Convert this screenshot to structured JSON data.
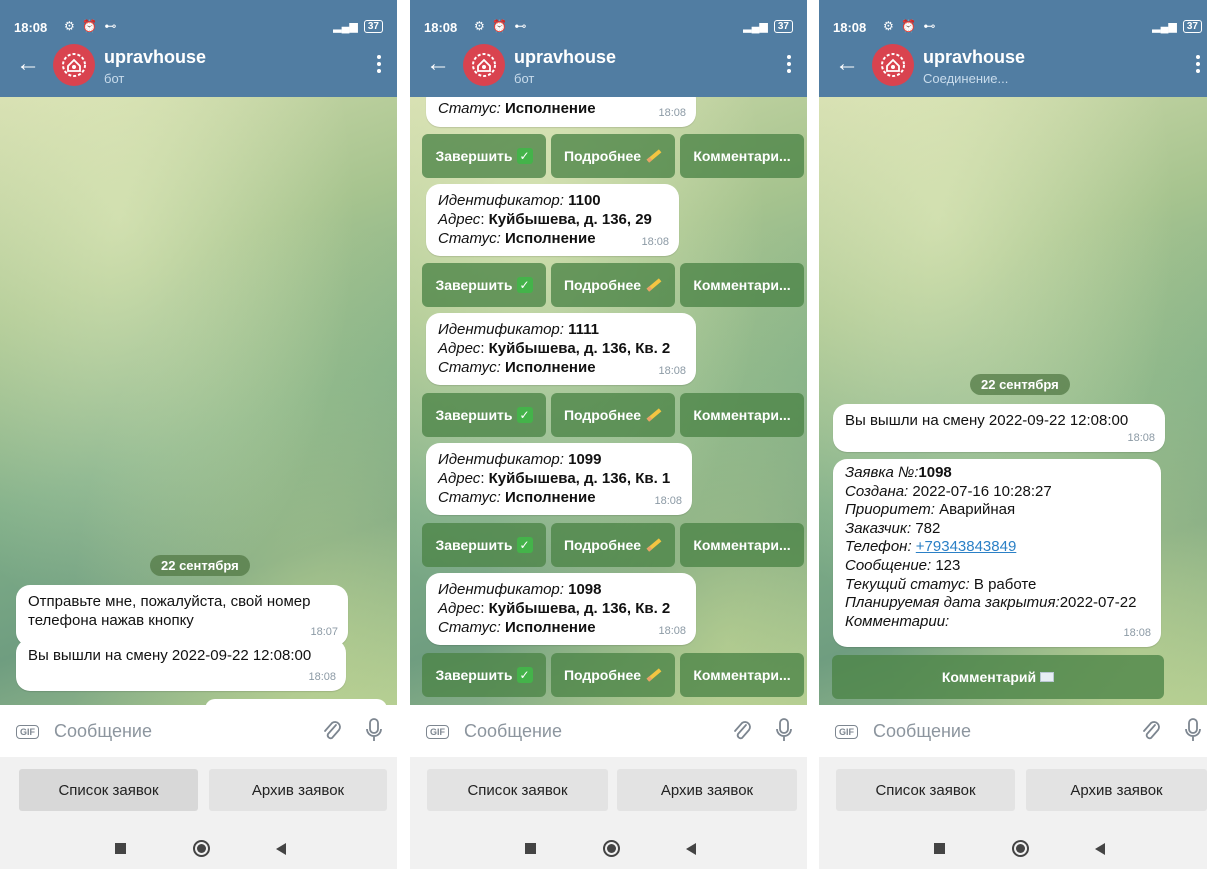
{
  "status_bar": {
    "time": "18:08",
    "icons": "⚙ ⏰ ⊷",
    "battery": "37",
    "signal": "📶"
  },
  "panels": [
    {
      "chat_title": "upravhouse",
      "chat_subtitle": "бот",
      "date_pill": "22 сентября",
      "messages": [
        {
          "text": "Отправьте мне, пожалуйста, свой номер телефона нажав кнопку",
          "time": "18:07"
        },
        {
          "text": "Вы вышли на смену 2022-09-22 12:08:00",
          "time": "18:08"
        }
      ]
    },
    {
      "chat_title": "upravhouse",
      "chat_subtitle": "бот",
      "top_partial": {
        "status_label": "Статус:",
        "status_value": "Исполнение",
        "time": "18:08"
      },
      "orders": [
        {
          "id_label": "Идентификатор:",
          "id": "1100",
          "addr_label": "Адрес",
          "addr": "Куйбышева, д. 136, 29",
          "status_label": "Статус:",
          "status": "Исполнение",
          "time": "18:08"
        },
        {
          "id_label": "Идентификатор:",
          "id": "1111",
          "addr_label": "Адрес",
          "addr": "Куйбышева, д. 136, Кв. 2",
          "status_label": "Статус:",
          "status": "Исполнение",
          "time": "18:08"
        },
        {
          "id_label": "Идентификатор:",
          "id": "1099",
          "addr_label": "Адрес",
          "addr": "Куйбышева, д. 136, Кв. 1",
          "status_label": "Статус:",
          "status": "Исполнение",
          "time": "18:08"
        },
        {
          "id_label": "Идентификатор:",
          "id": "1098",
          "addr_label": "Адрес",
          "addr": "Куйбышева, д. 136, Кв. 2",
          "status_label": "Статус:",
          "status": "Исполнение",
          "time": "18:08"
        }
      ],
      "inline_buttons": {
        "finish": "Завершить",
        "details": "Подробнее",
        "comment": "Комментари..."
      }
    },
    {
      "chat_title": "upravhouse",
      "chat_subtitle": "Соединение...",
      "date_pill": "22 сентября",
      "shift_message": {
        "text": "Вы вышли на смену 2022-09-22 12:08:00",
        "time": "18:08"
      },
      "ticket": {
        "number_label": "Заявка №:",
        "number": "1098",
        "created_label": "Создана:",
        "created": "2022-07-16 10:28:27",
        "priority_label": "Приоритет:",
        "priority": "Аварийная",
        "customer_label": "Заказчик:",
        "customer": "782",
        "phone_label": "Телефон:",
        "phone": "+79343843849",
        "message_label": "Сообщение:",
        "message": "123",
        "status_label": "Текущий статус:",
        "status": "В работе",
        "close_label": "Планируемая дата закрытия:",
        "close_date": "2022-07-22",
        "comments_label": "Комментарии:",
        "time": "18:08"
      },
      "comment_button": "Комментарий"
    }
  ],
  "input": {
    "placeholder": "Сообщение",
    "gif_label": "GIF"
  },
  "reply_keyboard": {
    "left": "Список заявок",
    "right": "Архив заявок"
  },
  "colors": {
    "header": "#517da2",
    "inline_button": "#4c8446",
    "link": "#2b80c6",
    "avatar": "#d9434f"
  }
}
